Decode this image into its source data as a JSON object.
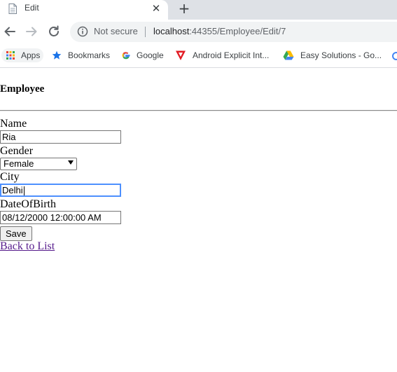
{
  "tab": {
    "title": "Edit",
    "close_glyph": "✕",
    "newtab_glyph": "+"
  },
  "toolbar": {
    "security_label": "Not secure",
    "url_host": "localhost",
    "url_path": ":44355/Employee/Edit/7"
  },
  "bookmarks": [
    {
      "label": "Apps",
      "icon": "apps-grid-icon"
    },
    {
      "label": "Bookmarks",
      "icon": "star-icon"
    },
    {
      "label": "Google",
      "icon": "google-icon"
    },
    {
      "label": "Android Explicit Int...",
      "icon": "android-icon"
    },
    {
      "label": "Easy Solutions - Go...",
      "icon": "drive-icon"
    }
  ],
  "page": {
    "heading": "Employee",
    "form": {
      "name_label": "Name",
      "name_value": "Ria",
      "gender_label": "Gender",
      "gender_value": "Female",
      "city_label": "City",
      "city_value": "Delhi",
      "dob_label": "DateOfBirth",
      "dob_value": "08/12/2000 12:00:00 AM",
      "save_label": "Save"
    },
    "back_link": "Back to List"
  },
  "colors": {
    "tabstrip": "#dee1e6",
    "omnibox": "#f1f3f4",
    "focus": "#4d90fe",
    "visited_link": "#551a8b"
  }
}
